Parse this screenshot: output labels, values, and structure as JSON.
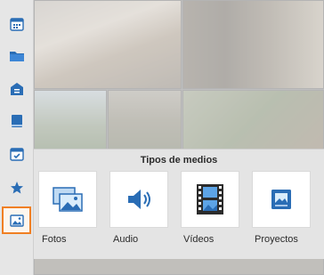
{
  "sidebar": {
    "icons": [
      "calendar-icon",
      "folder-icon",
      "home-icon",
      "book-icon",
      "calendar-check-icon",
      "star-icon",
      "image-icon"
    ],
    "active_index": 6,
    "accent_color": "#f07f23"
  },
  "media_panel": {
    "title": "Tipos de medios",
    "items": [
      {
        "label": "Fotos",
        "icon": "photos-icon"
      },
      {
        "label": "Audio",
        "icon": "speaker-icon"
      },
      {
        "label": "Vídeos",
        "icon": "film-icon"
      },
      {
        "label": "Proyectos",
        "icon": "project-album-icon"
      }
    ]
  }
}
